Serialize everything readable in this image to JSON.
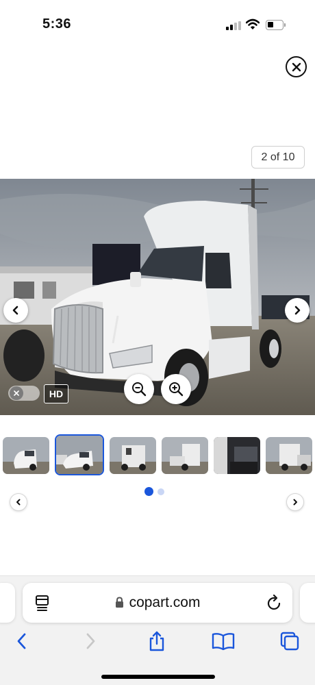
{
  "status_bar": {
    "time": "5:36",
    "icons": [
      "signal-icon",
      "wifi-icon",
      "battery-icon"
    ]
  },
  "viewer": {
    "close_icon": "close-icon",
    "counter": "2 of 10",
    "hd_label": "HD",
    "hd_enabled": false,
    "controls": [
      "chevron-left-icon",
      "chevron-right-icon",
      "zoom-out-icon",
      "zoom-in-icon"
    ]
  },
  "thumbnails": {
    "count_visible": 6,
    "selected_index": 1,
    "pager": {
      "pages": 2,
      "active": 0
    }
  },
  "browser": {
    "url": "copart.com",
    "icons": [
      "reader-icon",
      "lock-icon",
      "reload-icon",
      "back-icon",
      "forward-icon",
      "share-icon",
      "bookmarks-icon",
      "tabs-icon"
    ],
    "accent_color": "#1a56db",
    "disabled_color": "#c7c7c7"
  }
}
